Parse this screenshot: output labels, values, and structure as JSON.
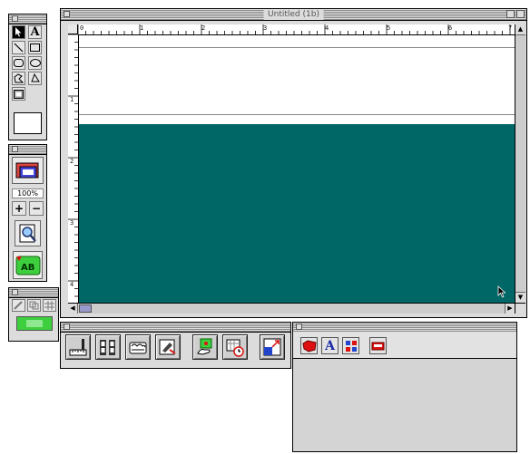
{
  "document_window": {
    "title": "Untitled (1b)",
    "ruler_h_labels": [
      "0",
      "1",
      "2",
      "3",
      "4",
      "5",
      "6",
      "7"
    ],
    "ruler_v_labels": [
      "1",
      "2",
      "3",
      "4"
    ],
    "canvas_top_color": "#ffffff",
    "canvas_fill_color": "#006666"
  },
  "tools_palette": {
    "tools": [
      "arrow-icon",
      "text-tool-icon",
      "line-icon",
      "rectangle-icon",
      "rounded-rect-icon",
      "oval-icon",
      "polygon-icon",
      "lasso-icon",
      "frame-icon"
    ],
    "text_tool_label": "A"
  },
  "view_palette": {
    "zoom_value": "100%",
    "zoom_in_label": "+",
    "zoom_out_label": "−"
  },
  "bottom_toolbar": {
    "buttons": [
      "ruler-tool-icon",
      "film-strip-icon",
      "hands-icon",
      "pencil-sketch-icon",
      "hand-plant-icon",
      "calendar-clock-icon",
      "window-resize-icon"
    ]
  },
  "objects_palette": {
    "text_button_label": "A"
  },
  "colors": {
    "chrome": "#dcdcdc",
    "accent_green": "#3ecf3e",
    "accent_red": "#dd1111"
  }
}
